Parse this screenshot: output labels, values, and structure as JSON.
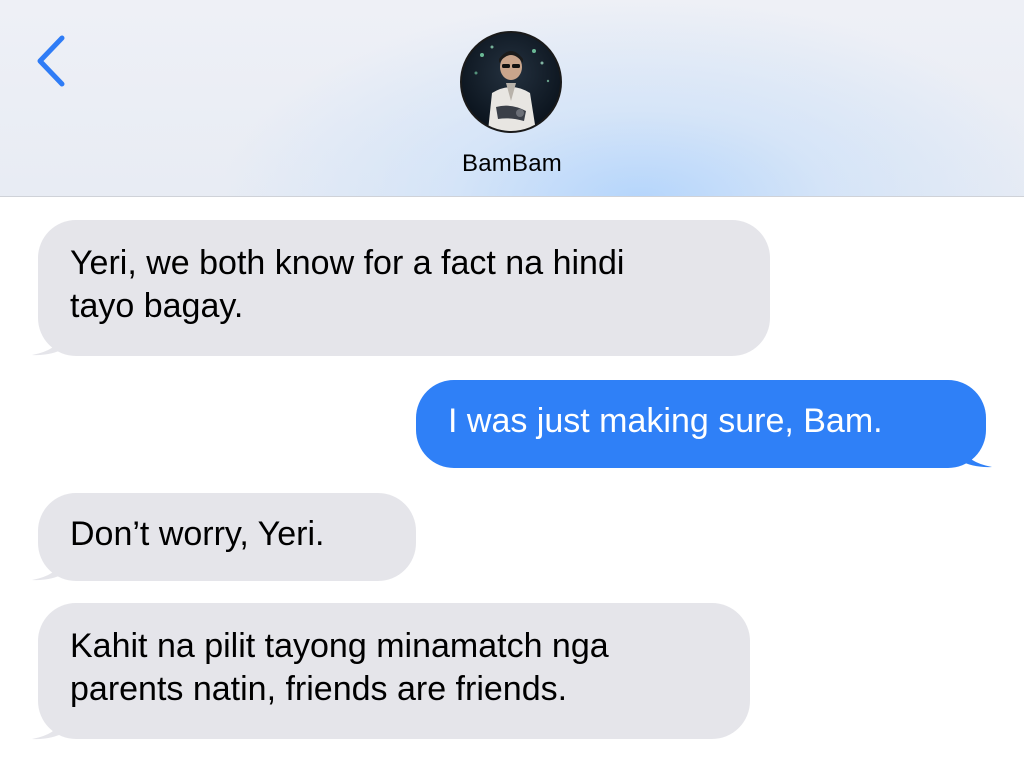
{
  "header": {
    "back_icon": "chevron-left-icon",
    "contact_name": "BamBam",
    "accent_color": "#2f7cf6"
  },
  "messages": [
    {
      "direction": "received",
      "text": "Yeri, we both know for a fact na hindi\ntayo bagay."
    },
    {
      "direction": "sent",
      "text": "I was just making sure, Bam."
    },
    {
      "direction": "received",
      "text": "Don’t worry, Yeri."
    },
    {
      "direction": "received",
      "text": "Kahit na pilit tayong minamatch nga\nparents natin, friends are friends."
    }
  ],
  "colors": {
    "received_bubble": "#e5e5ea",
    "sent_bubble": "#2f80f7",
    "received_text": "#000000",
    "sent_text": "#ffffff"
  }
}
